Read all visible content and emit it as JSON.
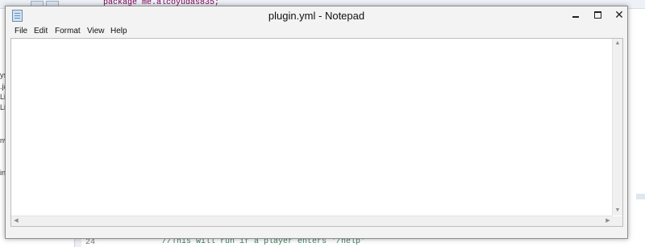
{
  "background_ide": {
    "top_code": "package me.alcoyudas835;",
    "left_panel_items": [
      "ys",
      ".ja",
      "Lib",
      "Lib",
      "nv",
      "in"
    ],
    "line_number": "24",
    "code_line": "//This will run if a player enters '/help'"
  },
  "notepad": {
    "title": "plugin.yml - Notepad",
    "controls": {
      "minimize": "minimize",
      "maximize": "maximize",
      "close": "✕"
    },
    "menu": [
      "File",
      "Edit",
      "Format",
      "View",
      "Help"
    ],
    "editor_content": "",
    "scroll_arrows": {
      "up": "▲",
      "down": "▼",
      "left": "◀",
      "right": "▶"
    }
  },
  "icons": [
    "notepad-app-icon",
    "minimize-icon",
    "maximize-icon",
    "close-icon"
  ]
}
